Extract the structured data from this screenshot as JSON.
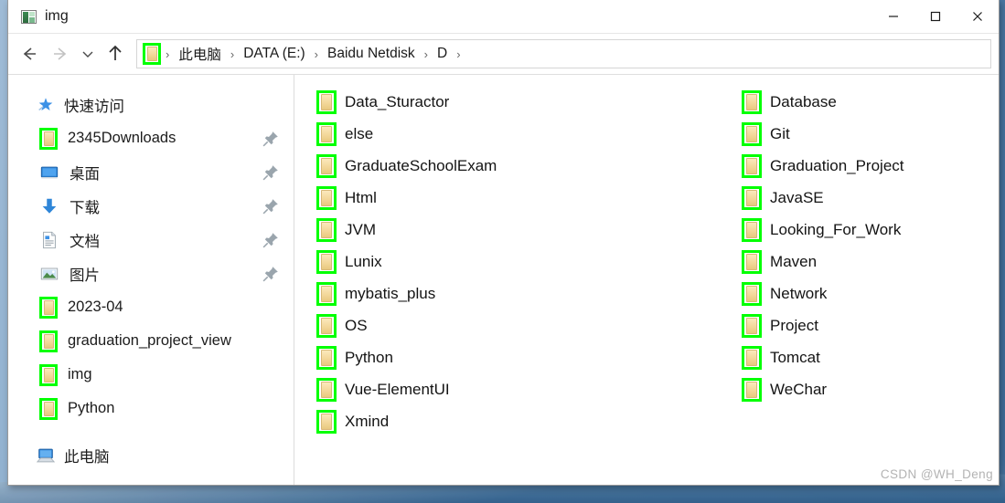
{
  "window": {
    "title": "img",
    "title_icon": "picture-folder-icon",
    "controls": {
      "minimize": "—",
      "maximize": "□",
      "close": "✕"
    }
  },
  "nav": {
    "back": "back-arrow",
    "forward": "forward-arrow",
    "recent": "chevron-down",
    "up": "up-arrow",
    "address_icon": "folder-icon",
    "breadcrumbs": [
      "此电脑",
      "DATA (E:)",
      "Baidu Netdisk",
      "D"
    ],
    "separator": "›"
  },
  "sidebar": {
    "quick_access": {
      "label": "快速访问",
      "icon": "star-pin-icon"
    },
    "pinned": [
      {
        "label": "2345Downloads",
        "icon": "green-folder-icon",
        "pinned": true
      },
      {
        "label": "桌面",
        "icon": "desktop-icon",
        "pinned": true
      },
      {
        "label": "下载",
        "icon": "downloads-icon",
        "pinned": true
      },
      {
        "label": "文档",
        "icon": "documents-icon",
        "pinned": true
      },
      {
        "label": "图片",
        "icon": "pictures-icon",
        "pinned": true
      }
    ],
    "recent": [
      {
        "label": "2023-04",
        "icon": "green-folder-icon"
      },
      {
        "label": "graduation_project_view",
        "icon": "green-folder-icon"
      },
      {
        "label": "img",
        "icon": "green-folder-icon"
      },
      {
        "label": "Python",
        "icon": "green-folder-icon"
      }
    ],
    "this_pc": {
      "label": "此电脑",
      "icon": "this-pc-icon"
    }
  },
  "main": {
    "columns": [
      {
        "items": [
          "Data_Sturactor",
          "else",
          "GraduateSchoolExam",
          "Html",
          "JVM",
          "Lunix",
          "mybatis_plus",
          "OS",
          "Python",
          "Vue-ElementUI",
          "Xmind"
        ]
      },
      {
        "items": [
          "Database",
          "Git",
          "Graduation_Project",
          "JavaSE",
          "Looking_For_Work",
          "Maven",
          "Network",
          "Project",
          "Tomcat",
          "WeChar"
        ]
      }
    ]
  },
  "watermark": "CSDN @WH_Deng",
  "colors": {
    "highlight": "#00ff00",
    "folder_fill": "#f3d89a",
    "window_bg": "#ffffff",
    "accent": "#0078d7"
  }
}
